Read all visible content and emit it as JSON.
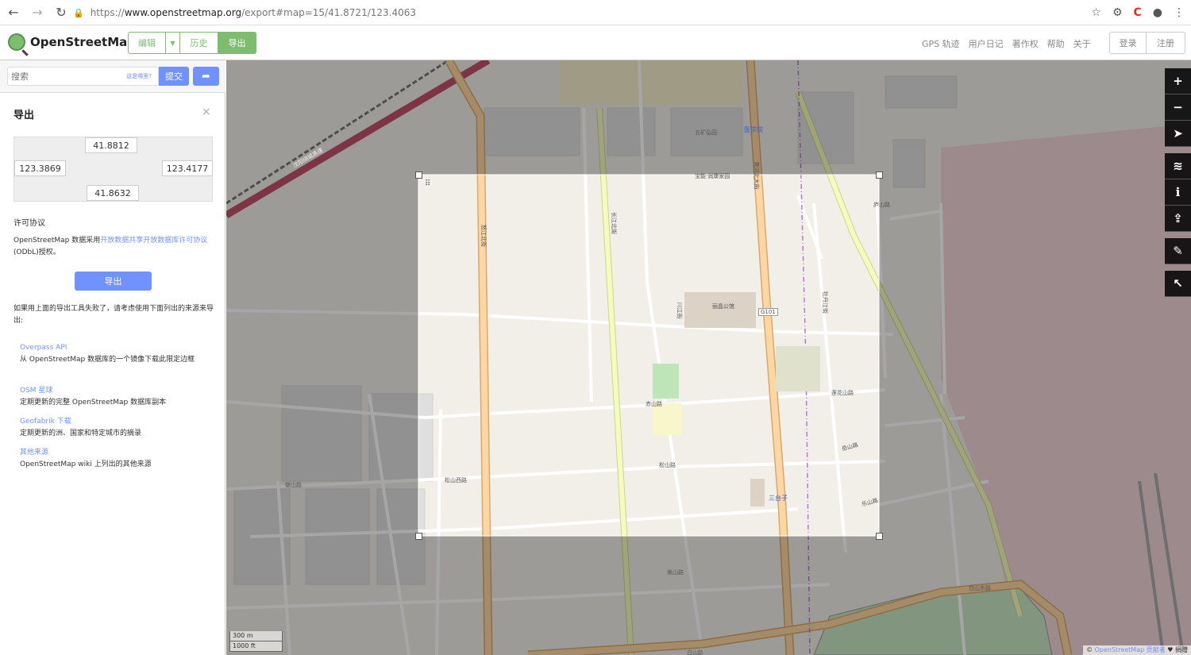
{
  "browser": {
    "url_prefix": "https://",
    "url_host": "www.openstreetmap.org",
    "url_path": "/export#map=15/41.8721/123.4063"
  },
  "header": {
    "logo_text": "OpenStreetMap",
    "modes": {
      "edit": "编辑",
      "history": "历史",
      "export": "导出"
    },
    "links": [
      "GPS 轨迹",
      "用户日记",
      "著作权",
      "帮助",
      "关于"
    ],
    "login": "登录",
    "signup": "注册"
  },
  "search": {
    "placeholder": "搜索",
    "where_link": "这是哪里?",
    "submit": "提交"
  },
  "export_panel": {
    "title": "导出",
    "close": "×",
    "bbox": {
      "north": "41.8812",
      "west": "123.3869",
      "east": "123.4177",
      "south": "41.8632"
    },
    "license_heading": "许可协议",
    "license_pre": "OpenStreetMap 数据采用",
    "license_link": "开放数据共享开放数据库许可协议",
    "license_post": " (ODbL)授权。",
    "export_button": "导出",
    "fallback_text": "如果用上面的导出工具失败了，请考虑使用下面列出的来源来导出:",
    "sources": [
      {
        "title": "Overpass API",
        "desc": "从 OpenStreetMap 数据库的一个镜像下载此限定边框"
      },
      {
        "title": "OSM 星球",
        "desc": "定期更新的完整 OpenStreetMap 数据库副本"
      },
      {
        "title": "Geofabrik 下载",
        "desc": "定期更新的洲、国家和特定城市的摘录"
      },
      {
        "title": "其他来源",
        "desc": "OpenStreetMap wiki 上列出的其他来源"
      }
    ]
  },
  "map": {
    "labels": [
      "医学院",
      "三台子",
      "G101",
      "丽晶公馆",
      "五矿弘园",
      "宝能·润康家园",
      "松山西路",
      "松山路",
      "莲花山路",
      "赤山路",
      "白山东路",
      "白山路",
      "长江北街",
      "黄河北大街",
      "怒江北街",
      "川江街",
      "牡丹江街",
      "乐山路",
      "沈阳绕城高速",
      "嵩山路",
      "岳山路",
      "银山路",
      "庐山路"
    ],
    "scale": {
      "metric": "300 m",
      "imperial": "1000 ft"
    },
    "attribution_pre": "© ",
    "attribution_link": "OpenStreetMap 贡献者",
    "attribution_post": " ♥ 捐赠"
  },
  "colors": {
    "accent": "#7092ff",
    "osm_green": "#7ebc6f",
    "primary_road": "#fcd6a4",
    "secondary_road": "#f7fabf",
    "motorway": "#e892a2"
  }
}
